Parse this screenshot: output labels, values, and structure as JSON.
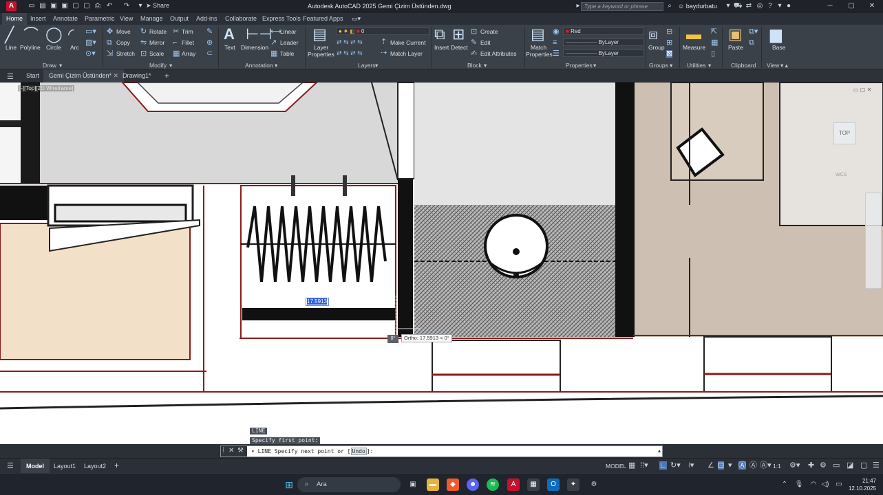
{
  "titlebar": {
    "app_logo": "A",
    "share": "Share",
    "title": "Autodesk AutoCAD 2025    Gemi Çizim Üstünden.dwg",
    "search_placeholder": "Type a keyword or phrase",
    "username": "baydurbatu"
  },
  "ribbon_tabs": [
    "Home",
    "Insert",
    "Annotate",
    "Parametric",
    "View",
    "Manage",
    "Output",
    "Add-ins",
    "Collaborate",
    "Express Tools",
    "Featured Apps"
  ],
  "ribbon": {
    "draw": {
      "line": "Line",
      "polyline": "Polyline",
      "circle": "Circle",
      "arc": "Arc",
      "title": "Draw"
    },
    "modify": {
      "move": "Move",
      "rotate": "Rotate",
      "trim": "Trim",
      "copy": "Copy",
      "mirror": "Mirror",
      "fillet": "Fillet",
      "stretch": "Stretch",
      "scale": "Scale",
      "array": "Array",
      "title": "Modify"
    },
    "annotation": {
      "text": "Text",
      "dimension": "Dimension",
      "linear": "Linear",
      "leader": "Leader",
      "table": "Table",
      "title": "Annotation"
    },
    "layers": {
      "layer_properties_1": "Layer",
      "layer_properties_2": "Properties",
      "current_layer": "0",
      "make_current": "Make Current",
      "match_layer": "Match Layer",
      "title": "Layers"
    },
    "block": {
      "insert": "Insert",
      "detect": "Detect",
      "create": "Create",
      "edit": "Edit",
      "edit_attributes": "Edit Attributes",
      "title": "Block"
    },
    "properties": {
      "match_1": "Match",
      "match_2": "Properties",
      "color": "Red",
      "linetype": "ByLayer",
      "lineweight": "ByLayer",
      "title": "Properties"
    },
    "groups": {
      "group": "Group",
      "title": "Groups"
    },
    "utilities": {
      "measure": "Measure",
      "title": "Utilities"
    },
    "clipboard": {
      "paste": "Paste",
      "title": "Clipboard"
    },
    "view": {
      "base": "Base",
      "title": "View"
    }
  },
  "file_tabs": {
    "start": "Start",
    "active": "Gemi Çizim Üstünden*",
    "drawing": "Drawing1*"
  },
  "viewport": {
    "label": "[-][Top][2D Wireframe]",
    "viewcube": "TOP",
    "wcs": "WCS",
    "dim_input": "17.5913",
    "ortho_tooltip": "Ortho: 17.5913 < 0°",
    "snap_marker": "0°"
  },
  "command": {
    "history_1": "LINE",
    "history_2": "Specify first point:",
    "prompt_prefix": "LINE Specify next point or [",
    "prompt_keyword": "Undo",
    "prompt_suffix": "]:"
  },
  "status": {
    "model_tab": "Model",
    "layout1": "Layout1",
    "layout2": "Layout2",
    "model_label": "MODEL",
    "scale": "1:1"
  },
  "taskbar": {
    "search": "Ara",
    "time": "21:47",
    "date": "12.10.2025"
  },
  "colors": {
    "accent_red": "#c8102e",
    "selection_blue": "#2a5bd7",
    "drawing_red_line": "#8b1a1a"
  }
}
